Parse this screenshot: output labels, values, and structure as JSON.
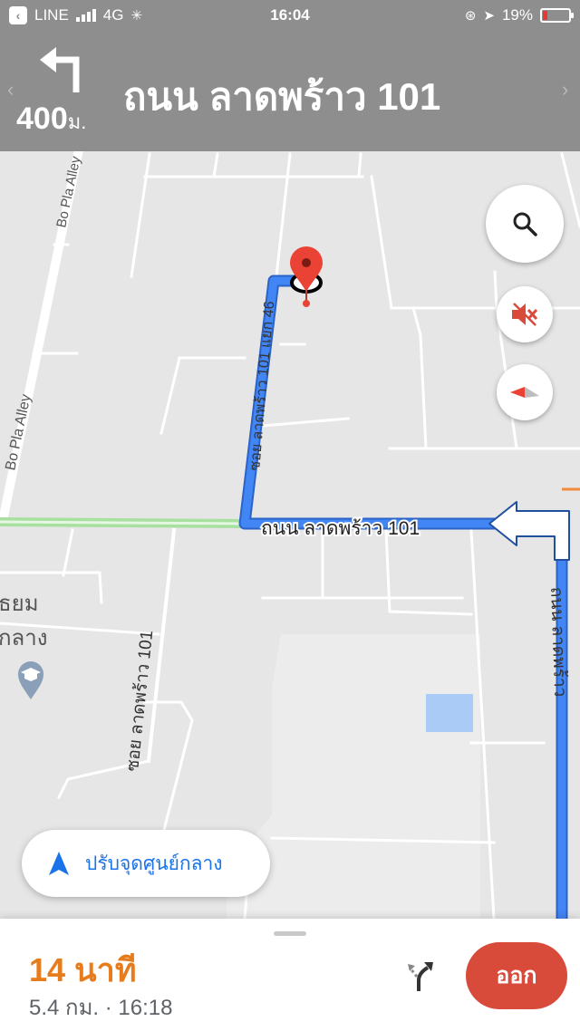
{
  "status_bar": {
    "back_app": "LINE",
    "network": "4G",
    "time": "16:04",
    "battery": "19%",
    "battery_level": 0.19
  },
  "navigation": {
    "distance_value": "400",
    "distance_unit": "ม.",
    "street_name": "ถนน ลาดพร้าว 101",
    "turn_icon": "turn-left-arrow"
  },
  "map": {
    "labels": {
      "bo_pla_alley_top": "Bo Pla Alley",
      "bo_pla_alley_left": "Bo Pla Alley",
      "soi_46": "ซอย ลาดพร้าว 101 แยก 46",
      "main_road": "ถนน ลาดพร้าว 101",
      "soi_101": "ซอย ลาดพร้าว 101",
      "right_road": "ถนน ลาดพร้าว",
      "school_line1": "ธยม",
      "school_line2": "กลาง"
    },
    "colors": {
      "route": "#4285f4",
      "route_outline": "#2b63c7",
      "destination_pin": "#ea4335",
      "secondary_route": "#a8e0a0"
    }
  },
  "controls": {
    "search_icon": "search-icon",
    "mute_icon": "sound-off-icon",
    "compass_icon": "compass-icon",
    "recenter_label": "ปรับจุดศูนย์กลาง"
  },
  "trip": {
    "duration": "14 นาที",
    "details": "5.4 กม. · 16:18",
    "exit_label": "ออก",
    "accent_color": "#e67c1b",
    "exit_color": "#d84a3a"
  }
}
